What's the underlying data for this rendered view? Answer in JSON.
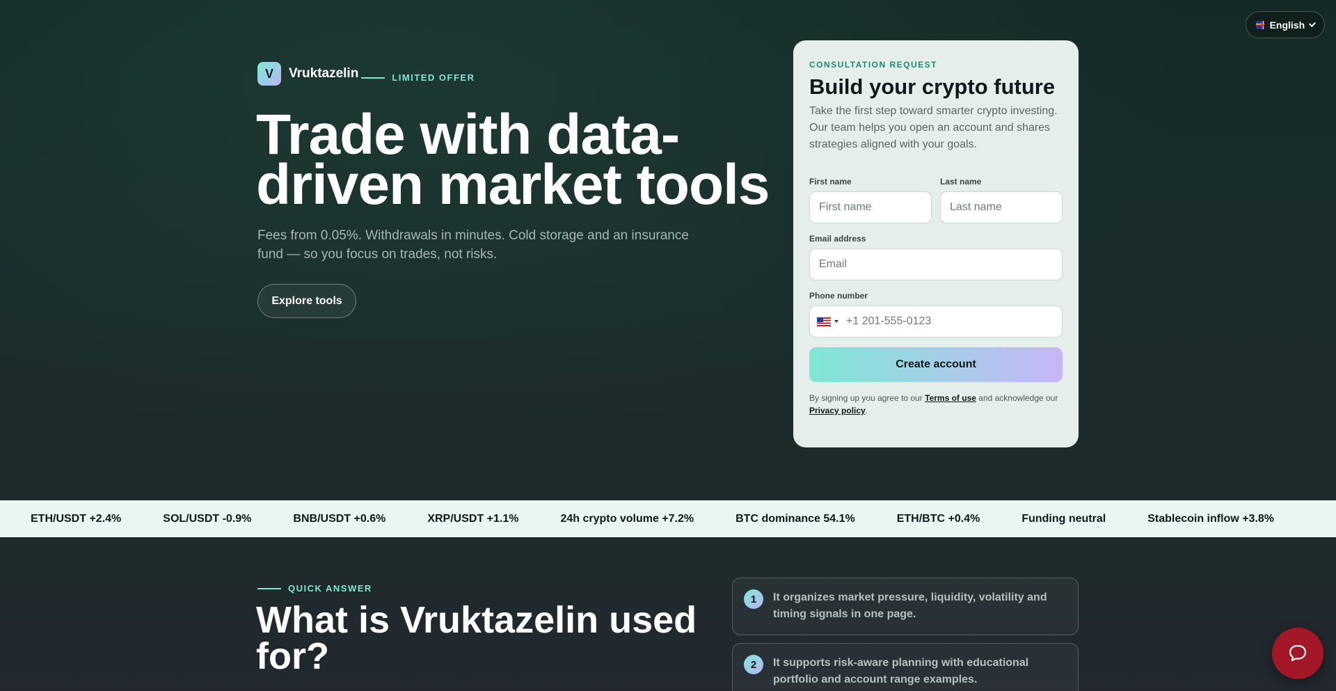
{
  "language": {
    "current": "English",
    "flag_icon": "uk-flag-icon"
  },
  "brand": {
    "logo_letter": "V",
    "name": "Vruktazelin",
    "offer": "LIMITED OFFER"
  },
  "hero": {
    "title": "Trade with data-driven market tools",
    "subtitle": "Fees from 0.05%. Withdrawals in minutes. Cold storage and an insurance fund — so you focus on trades, not risks.",
    "cta": "Explore tools"
  },
  "form": {
    "eyebrow": "CONSULTATION REQUEST",
    "title": "Build your crypto future",
    "description": "Take the first step toward smarter crypto investing. Our team helps you open an account and shares strategies aligned with your goals.",
    "first_name_label": "First name",
    "first_name_placeholder": "First name",
    "last_name_label": "Last name",
    "last_name_placeholder": "Last name",
    "email_label": "Email address",
    "email_placeholder": "Email",
    "phone_label": "Phone number",
    "phone_placeholder": "+1 201-555-0123",
    "phone_country_icon": "us-flag-icon",
    "submit": "Create account",
    "legal_prefix": "By signing up you agree to our",
    "terms_link": "Terms of use",
    "legal_middle": "and acknowledge our",
    "privacy_link": "Privacy policy",
    "legal_suffix": "."
  },
  "ticker": [
    "ETH/USDT +2.4%",
    "SOL/USDT -0.9%",
    "BNB/USDT +0.6%",
    "XRP/USDT +1.1%",
    "24h crypto volume +7.2%",
    "BTC dominance 54.1%",
    "ETH/BTC +0.4%",
    "Funding neutral",
    "Stablecoin inflow +3.8%"
  ],
  "quick_answer": {
    "eyebrow": "QUICK ANSWER",
    "title": "What is Vruktazelin used for?",
    "items": [
      {
        "num": "1",
        "text": "It organizes market pressure, liquidity, volatility and timing signals in one page."
      },
      {
        "num": "2",
        "text": "It supports risk-aware planning with educational portfolio and account range examples."
      }
    ]
  },
  "chat": {
    "icon": "chat-bubble-icon"
  },
  "colors": {
    "accent": "#7fe7d4",
    "accent2": "#c7b6f7",
    "card_bg": "#e6eeeb",
    "chat_bg": "#a31728",
    "eyebrow_green": "#1e8a6a"
  }
}
